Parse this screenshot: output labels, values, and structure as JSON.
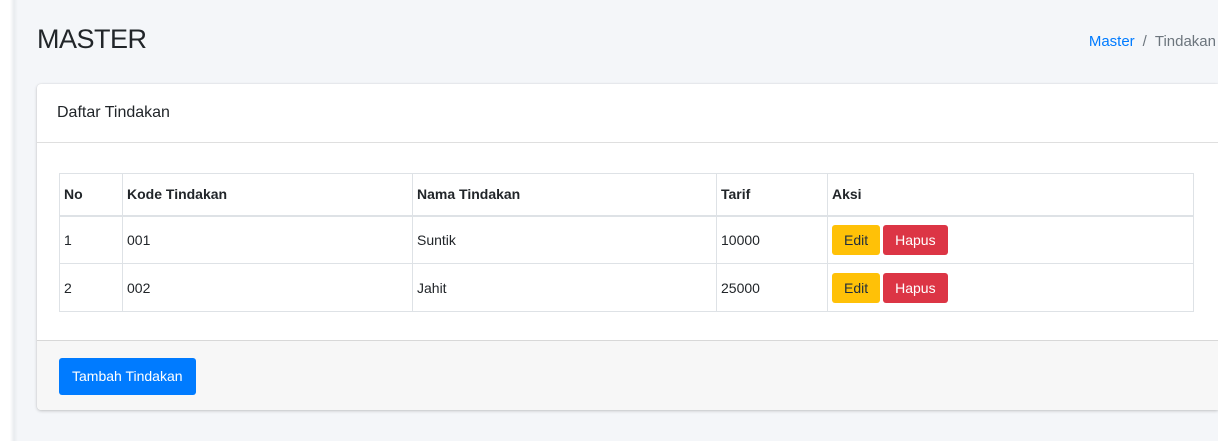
{
  "header": {
    "title": "MASTER",
    "breadcrumb": {
      "link": "Master",
      "separator": "/",
      "current": "Tindakan"
    }
  },
  "card": {
    "title": "Daftar Tindakan",
    "table": {
      "headers": [
        "No",
        "Kode Tindakan",
        "Nama Tindakan",
        "Tarif",
        "Aksi"
      ],
      "rows": [
        {
          "no": "1",
          "kode": "001",
          "nama": "Suntik",
          "tarif": "10000"
        },
        {
          "no": "2",
          "kode": "002",
          "nama": "Jahit",
          "tarif": "25000"
        }
      ],
      "edit_label": "Edit",
      "delete_label": "Hapus"
    },
    "footer": {
      "add_button_label": "Tambah Tindakan"
    }
  },
  "colors": {
    "primary": "#007bff",
    "warning": "#ffc107",
    "danger": "#dc3545"
  }
}
